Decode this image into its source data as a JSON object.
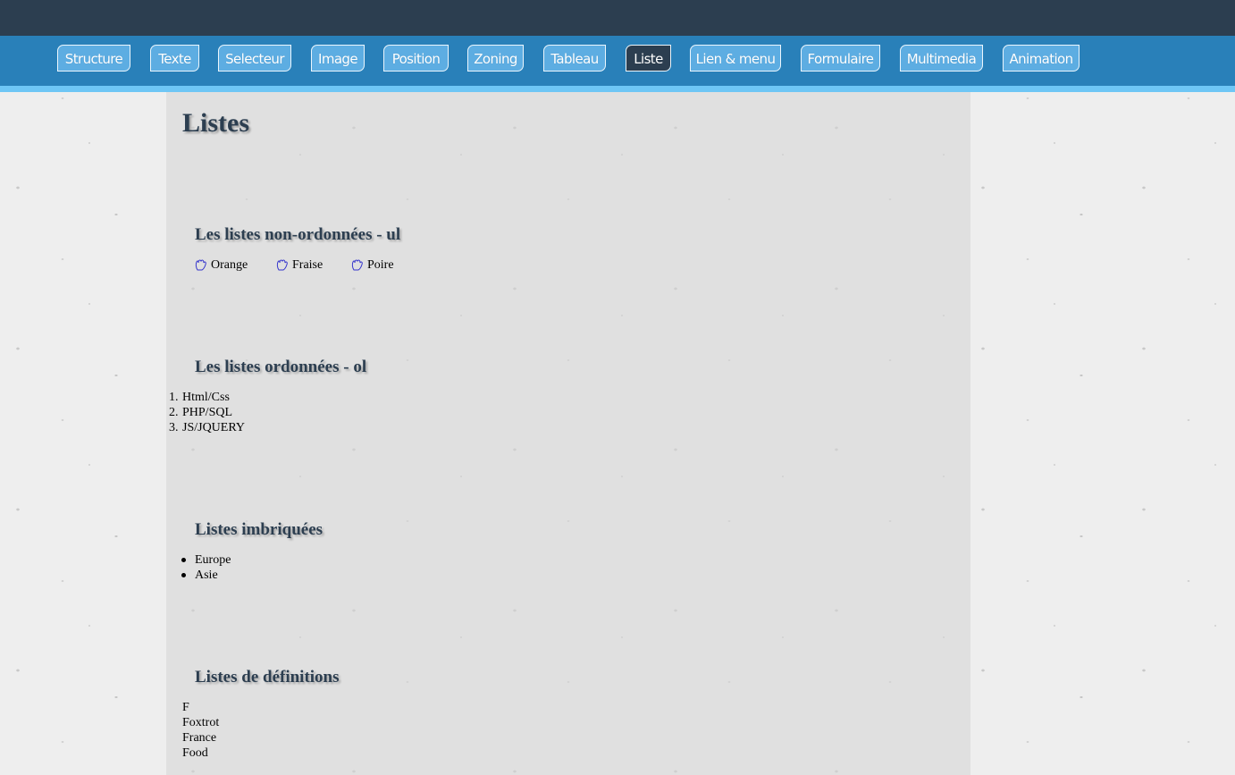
{
  "nav": {
    "items": [
      {
        "label": "Structure"
      },
      {
        "label": "Texte"
      },
      {
        "label": "Selecteur"
      },
      {
        "label": "Image"
      },
      {
        "label": "Position"
      },
      {
        "label": "Zoning"
      },
      {
        "label": "Tableau"
      },
      {
        "label": "Liste",
        "active": true
      },
      {
        "label": "Lien & menu"
      },
      {
        "label": "Formulaire"
      },
      {
        "label": "Multimedia"
      },
      {
        "label": "Animation"
      }
    ]
  },
  "page": {
    "title": "Listes"
  },
  "sections": {
    "unordered": {
      "title": "Les listes non-ordonnées - ul",
      "bullet_icon": "flower-icon",
      "items": [
        "Orange",
        "Fraise",
        "Poire"
      ]
    },
    "ordered": {
      "title": "Les listes ordonnées - ol",
      "items": [
        {
          "number": "1.",
          "label": "Html/Css"
        },
        {
          "number": "2.",
          "label": "PHP/SQL"
        },
        {
          "number": "3.",
          "label": "JS/JQUERY"
        }
      ]
    },
    "nested": {
      "title": "Listes imbriquées",
      "items": [
        "Europe",
        "Asie"
      ]
    },
    "definitions": {
      "title": "Listes de définitions",
      "lines": [
        "F",
        "Foxtrot",
        "France",
        "Food"
      ]
    }
  },
  "colors": {
    "topbar": "#2c3e50",
    "navbar": "#2980b9",
    "nav_tab": "#5dade2",
    "nav_tab_active": "#2c3e50",
    "stripe": "#6ec6f5",
    "heading": "#2c3e50",
    "flower_icon": "#3333cc"
  }
}
